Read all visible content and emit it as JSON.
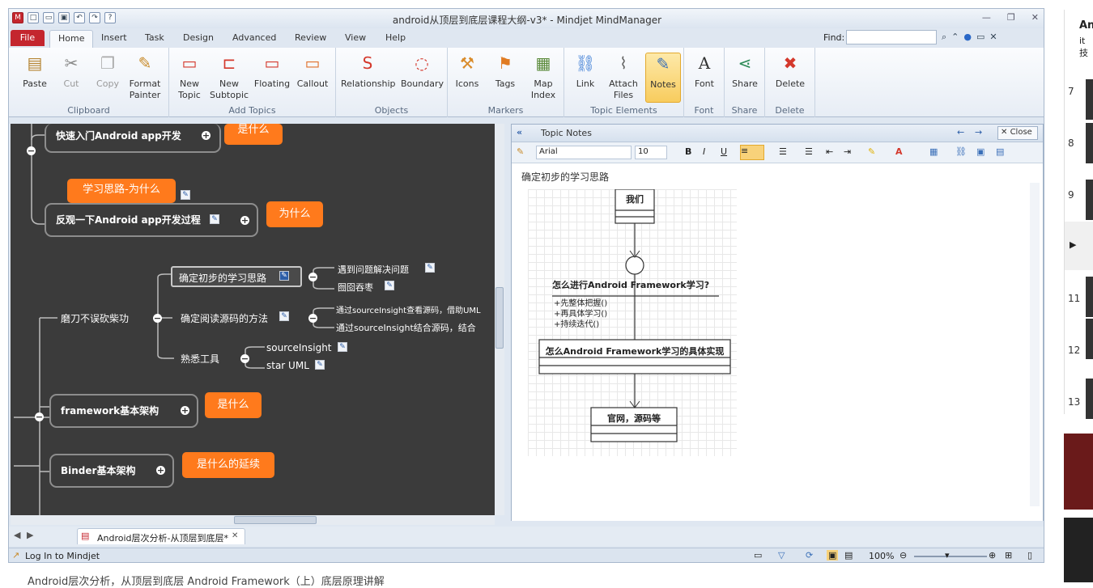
{
  "title": "android从顶层到底层课程大纲-v3* - Mindjet MindManager",
  "tabs": {
    "file": "File",
    "home": "Home",
    "insert": "Insert",
    "task": "Task",
    "design": "Design",
    "advanced": "Advanced",
    "review": "Review",
    "view": "View",
    "help": "Help"
  },
  "find": {
    "label": "Find:",
    "value": ""
  },
  "ribbon": {
    "paste": "Paste",
    "cut": "Cut",
    "copy": "Copy",
    "format_painter": "Format\nPainter",
    "clipboard": "Clipboard",
    "new_topic": "New\nTopic",
    "new_subtopic": "New\nSubtopic",
    "floating": "Floating",
    "callout": "Callout",
    "add_topics": "Add Topics",
    "relationship": "Relationship",
    "boundary": "Boundary",
    "objects": "Objects",
    "icons": "Icons",
    "tags": "Tags",
    "map_index": "Map\nIndex",
    "markers": "Markers",
    "link": "Link",
    "attach_files": "Attach\nFiles",
    "notes": "Notes",
    "topic_elements": "Topic Elements",
    "font": "Font",
    "font_group": "Font",
    "share": "Share",
    "share_group": "Share",
    "delete": "Delete",
    "delete_group": "Delete"
  },
  "map": {
    "n1": "快速入门Android app开发",
    "c1": "是什么",
    "c2": "学习思路-为什么",
    "n2": "反观一下Android app开发过程",
    "c3": "为什么",
    "n3": "磨刀不误砍柴功",
    "n4": "确定初步的学习思路",
    "n5": "遇到问题解决问题",
    "n6": "囫囵吞枣",
    "n7": "确定阅读源码的方法",
    "n8": "通过sourceInsight查看源码，借助UML",
    "n9": "通过sourceInsight结合源码，结合",
    "n10": "熟悉工具",
    "n11": "sourceInsight",
    "n12": "star UML",
    "n13": "framework基本架构",
    "c4": "是什么",
    "n14": "Binder基本架构",
    "c5": "是什么的延续"
  },
  "notes": {
    "title": "Topic Notes",
    "close": "Close",
    "font": "Arial",
    "size": "10",
    "heading": "确定初步的学习思路",
    "uml_we": "我们",
    "uml_q": "怎么进行Android Framework学习?",
    "m1": "+先整体把握()",
    "m2": "+再具体学习()",
    "m3": "+持续迭代()",
    "uml_impl": "怎么Android Framework学习的具体实现",
    "uml_site": "官网，源码等"
  },
  "doc_tab": "Android层次分析-从顶层到底层*",
  "status": {
    "login": "Log In to Mindjet",
    "zoom": "100%"
  },
  "sidebar": {
    "title": "And",
    "sub": "it技",
    "items": [
      "7",
      "8",
      "9",
      "11",
      "12",
      "13"
    ]
  },
  "bottom_text": "Android层次分析，从顶层到底层 Android Framework（上）底层原理讲解"
}
